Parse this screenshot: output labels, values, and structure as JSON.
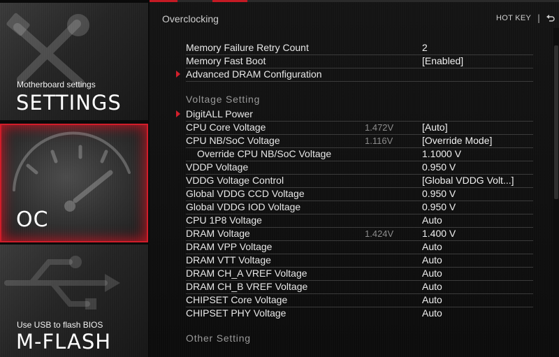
{
  "sidebar": {
    "settings": {
      "subtitle": "Motherboard settings",
      "title": "SETTINGS"
    },
    "oc": {
      "title": "OC"
    },
    "mflash": {
      "subtitle": "Use USB to flash BIOS",
      "title": "M-FLASH"
    }
  },
  "header": {
    "title": "Overclocking",
    "hotkey": "HOT KEY",
    "separator": "|",
    "back_icon": "back-arrow-icon"
  },
  "rows_top": [
    {
      "label": "Memory Failure Retry Count",
      "value": "2"
    },
    {
      "label": "Memory Fast Boot",
      "value": "[Enabled]"
    },
    {
      "label": "Advanced DRAM Configuration",
      "value": ""
    }
  ],
  "voltage_section": {
    "header": "Voltage  Setting",
    "rows": [
      {
        "label": "DigitALL Power",
        "current": "",
        "value": ""
      },
      {
        "label": "CPU Core Voltage",
        "current": "1.472V",
        "value": "[Auto]"
      },
      {
        "label": "CPU NB/SoC Voltage",
        "current": "1.116V",
        "value": "[Override Mode]"
      },
      {
        "label": "Override CPU NB/SoC Voltage",
        "current": "",
        "value": "1.1000 V"
      },
      {
        "label": "VDDP Voltage",
        "current": "",
        "value": "0.950 V"
      },
      {
        "label": "VDDG Voltage Control",
        "current": "",
        "value": "[Global VDDG Volt...]"
      },
      {
        "label": "Global VDDG CCD Voltage",
        "current": "",
        "value": "0.950 V"
      },
      {
        "label": "Global VDDG IOD Voltage",
        "current": "",
        "value": "0.950 V"
      },
      {
        "label": "CPU 1P8 Voltage",
        "current": "",
        "value": "Auto"
      },
      {
        "label": "DRAM Voltage",
        "current": "1.424V",
        "value": "1.400 V"
      },
      {
        "label": "DRAM VPP Voltage",
        "current": "",
        "value": "Auto"
      },
      {
        "label": "DRAM VTT Voltage",
        "current": "",
        "value": "Auto"
      },
      {
        "label": "DRAM CH_A VREF Voltage",
        "current": "",
        "value": "Auto"
      },
      {
        "label": "DRAM CH_B VREF Voltage",
        "current": "",
        "value": "Auto"
      },
      {
        "label": "CHIPSET Core Voltage",
        "current": "",
        "value": "Auto"
      },
      {
        "label": "CHIPSET PHY Voltage",
        "current": "",
        "value": "Auto"
      }
    ]
  },
  "other_section": {
    "header": "Other  Setting"
  },
  "colors": {
    "accent": "#d11d2a",
    "background": "#0c0c0c",
    "text": "#e8e8e8",
    "muted": "#8c8c8c"
  }
}
